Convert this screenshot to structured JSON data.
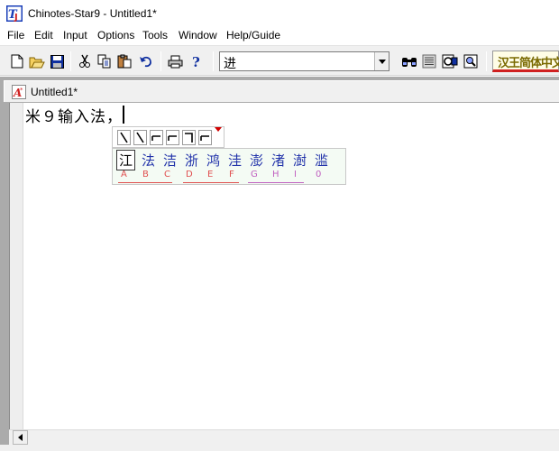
{
  "window": {
    "title": "Chinotes-Star9 - Untitled1*"
  },
  "menu": {
    "items": [
      "File",
      "Edit",
      "Input",
      "Options",
      "Tools",
      "Window",
      "Help/Guide"
    ]
  },
  "toolbar": {
    "buttons": [
      "new-file",
      "open-folder",
      "save",
      "cut",
      "copy",
      "paste",
      "undo",
      "print",
      "help",
      "find",
      "text-view",
      "convert",
      "zoom"
    ],
    "font_combo_value": "进",
    "ime_logo_text": "汉王简体中文"
  },
  "document": {
    "tab_title": "Untitled1*",
    "text": "米９输入法，"
  },
  "ime": {
    "stroke_buttons": [
      "㇏",
      "㇏",
      "㇀",
      "㇀",
      "㇆",
      "㇀"
    ],
    "candidates": [
      "江",
      "法",
      "洁",
      "浙",
      "鸿",
      "洼",
      "澎",
      "渚",
      "澍",
      "滥"
    ],
    "keys": [
      "A",
      "B",
      "C",
      "D",
      "E",
      "F",
      "G",
      "H",
      "I",
      "0"
    ]
  },
  "colors": {
    "accent_red": "#d02020",
    "candidate_blue": "#2233aa",
    "mdi_gray": "#ababab"
  }
}
